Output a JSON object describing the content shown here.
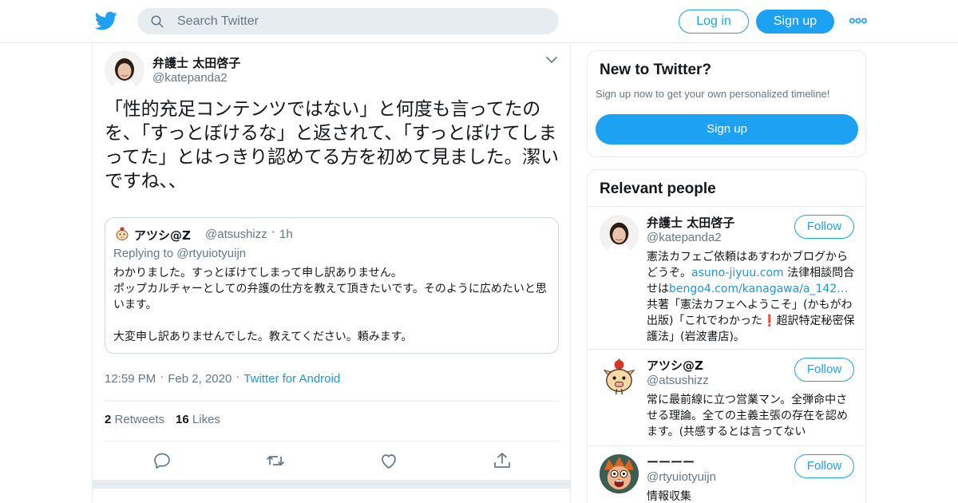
{
  "header": {
    "search_placeholder": "Search Twitter",
    "login_label": "Log in",
    "signup_label": "Sign up",
    "brand_color": "#1da1f2"
  },
  "tweet": {
    "author_name": "弁護士 太田啓子",
    "author_handle": "@katepanda2",
    "text": "「性的充足コンテンツではない」と何度も言ってたのを、「すっとぼけるな」と返されて、「すっとぼけてしまってた」とはっきり認めてる方を初めて見ました。潔いですね、、",
    "quoted": {
      "author_name": "アツシ@Z",
      "author_handle": "@atsushizz",
      "separator": "·",
      "time": "1h",
      "replying_to": "Replying to @rtyuiotyuijn",
      "line1": "わかりました。すっとぼけてしまって申し訳ありません。",
      "line2": "ポップカルチャーとしての弁護の仕方を教えて頂きたいです。そのように広めたいと思います。",
      "line3": "大変申し訳ありませんでした。教えてください。頼みます。"
    },
    "time": "12:59 PM",
    "date": "Feb 2, 2020",
    "source": "Twitter for Android",
    "separator": "·",
    "retweets_count": "2",
    "retweets_label": "Retweets",
    "likes_count": "16",
    "likes_label": "Likes"
  },
  "sidebar": {
    "new_title": "New to Twitter?",
    "new_subtitle": "Sign up now to get your own personalized timeline!",
    "new_signup_label": "Sign up",
    "relevant_title": "Relevant people",
    "people": [
      {
        "name": "弁護士 太田啓子",
        "handle": "@katepanda2",
        "follow_label": "Follow",
        "bio_a": "憲法カフェご依頼はあすわかブログからどうぞ。",
        "bio_link1": "asuno-jiyuu.com",
        "bio_b": " 法律相談問合せは",
        "bio_link2": "bengo4.com/kanagawa/a_142…",
        "bio_c": " 共著「憲法カフェへようこそ」(かもがわ出版)「これでわかった",
        "bio_emoji": "❗",
        "bio_d": "超訳特定秘密保護法」(岩波書店)。"
      },
      {
        "name": "アツシ@Z",
        "handle": "@atsushizz",
        "follow_label": "Follow",
        "bio": "常に最前線に立つ営業マン。全弾命中させる理論。全ての主義主張の存在を認めます。(共感するとは言ってない"
      },
      {
        "name": "ーーーー",
        "handle": "@rtyuiotyuijn",
        "follow_label": "Follow",
        "bio": "情報収集"
      }
    ]
  }
}
